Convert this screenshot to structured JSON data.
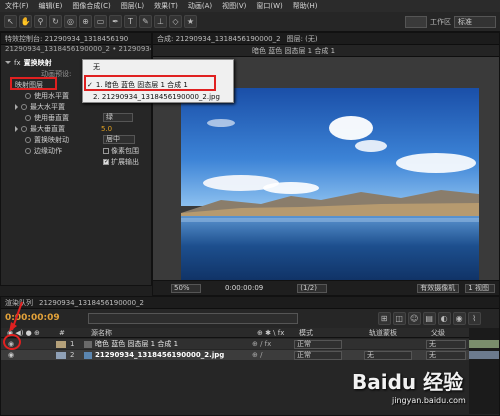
{
  "menu": [
    "文件(F)",
    "编辑(E)",
    "图像合成(C)",
    "图层(L)",
    "效果(T)",
    "动画(A)",
    "视图(V)",
    "窗口(W)",
    "帮助(H)"
  ],
  "workspace": {
    "label": "工作区",
    "value": "标准"
  },
  "effects_panel": {
    "tab": "特效控制台: 21290934_1318456190",
    "breadcrumb": "21290934_1318456190000_2 • 21290934_1318456190",
    "effect_name": "置换映射",
    "rows": [
      {
        "label": "映射图层",
        "value": ""
      },
      {
        "label": "使用水平置",
        "value": ""
      },
      {
        "label": "最大水平置",
        "value": ""
      },
      {
        "label": "使用垂直置",
        "value": "绿"
      },
      {
        "label": "最大垂直置",
        "value": "5.0"
      },
      {
        "label": "置换映射动",
        "value": "居中"
      },
      {
        "label": "边缘动作",
        "value": "像素包围"
      },
      {
        "label": "",
        "value": "扩展输出"
      }
    ],
    "partial_label": "动画预设:"
  },
  "map_layer_dropdown": {
    "none_label": "无",
    "items": [
      "1. 暗色 蓝色 固态层 1 合成 1",
      "2. 21290934_1318456190000_2.jpg"
    ],
    "checked_index": 0
  },
  "composition_panel": {
    "tab": "合成: 21290934_1318456190000_2",
    "tab2": "图层: (无)",
    "subtab": "暗色 蓝色 固态层 1 合成 1",
    "zoom": "50%",
    "timecode": "0:00:00:09",
    "resolution": "(1/2)",
    "camera": "有效摄像机",
    "views": "1 视图"
  },
  "timeline": {
    "tab": "渲染队列",
    "comp_tab": "21290934_1318456190000_2",
    "timecode": "0:00:00:09",
    "headers": {
      "name": "源名称",
      "mode": "模式",
      "trkmat": "轨道蒙板",
      "parent": "父级"
    },
    "layers": [
      {
        "num": "1",
        "name": "暗色 蓝色 固态层 1 合成 1",
        "mode": "正常",
        "trkmat": "",
        "parent": "无"
      },
      {
        "num": "2",
        "name": "21290934_1318456190000_2.jpg",
        "mode": "正常",
        "trkmat": "无",
        "parent": "无"
      }
    ]
  },
  "watermark": {
    "logo": "Baidu 经验",
    "url": "jingyan.baidu.com"
  }
}
